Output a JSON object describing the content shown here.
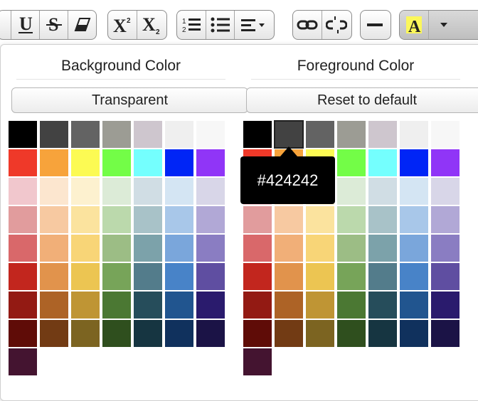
{
  "background": {
    "title": "Background Color",
    "button_label": "Transparent"
  },
  "foreground": {
    "title": "Foreground Color",
    "button_label": "Reset to default",
    "selected_color": "#424242"
  },
  "tooltip": {
    "text": "#424242"
  },
  "palette": [
    [
      "#000000",
      "#424242",
      "#636363",
      "#9c9c94",
      "#cec6ce",
      "#efefef",
      "#f7f7f7"
    ],
    [
      "#ef3929",
      "#f7a33b",
      "#fcfa53",
      "#73fd47",
      "#74fffe",
      "#0025f6",
      "#9035f7"
    ],
    [
      "#f1c7cd",
      "#fce6cf",
      "#fdf1cf",
      "#dcebd7",
      "#d0dde4",
      "#d4e5f3",
      "#d8d6e8"
    ],
    [
      "#e19c9d",
      "#f7c9a1",
      "#fbe39e",
      "#bbd9ac",
      "#a8c2c8",
      "#a8c7e9",
      "#b1a8d6"
    ],
    [
      "#d9686a",
      "#f1af78",
      "#f8d577",
      "#9cbd85",
      "#7ca2aa",
      "#7aa6db",
      "#8a7dc2"
    ],
    [
      "#c2261e",
      "#e1934c",
      "#ecc552",
      "#77a459",
      "#537c8b",
      "#4883c8",
      "#5f4ea1"
    ],
    [
      "#931a13",
      "#ad6326",
      "#bf9534",
      "#4b7833",
      "#264d5b",
      "#21558f",
      "#2a1b6d"
    ],
    [
      "#5f0c07",
      "#723b14",
      "#7c6421",
      "#2f4f1e",
      "#163541",
      "#10315d",
      "#1b1346"
    ],
    [
      "#441430"
    ]
  ],
  "toolbar": {
    "icons": [
      "underline-icon",
      "strikethrough-icon",
      "eraser-icon",
      "superscript-icon",
      "subscript-icon",
      "ordered-list-icon",
      "unordered-list-icon",
      "align-icon",
      "link-icon",
      "unlink-icon",
      "horizontal-rule-icon",
      "text-color-icon",
      "dropdown-arrow-icon"
    ],
    "accent_highlight": "#fbf75a"
  }
}
